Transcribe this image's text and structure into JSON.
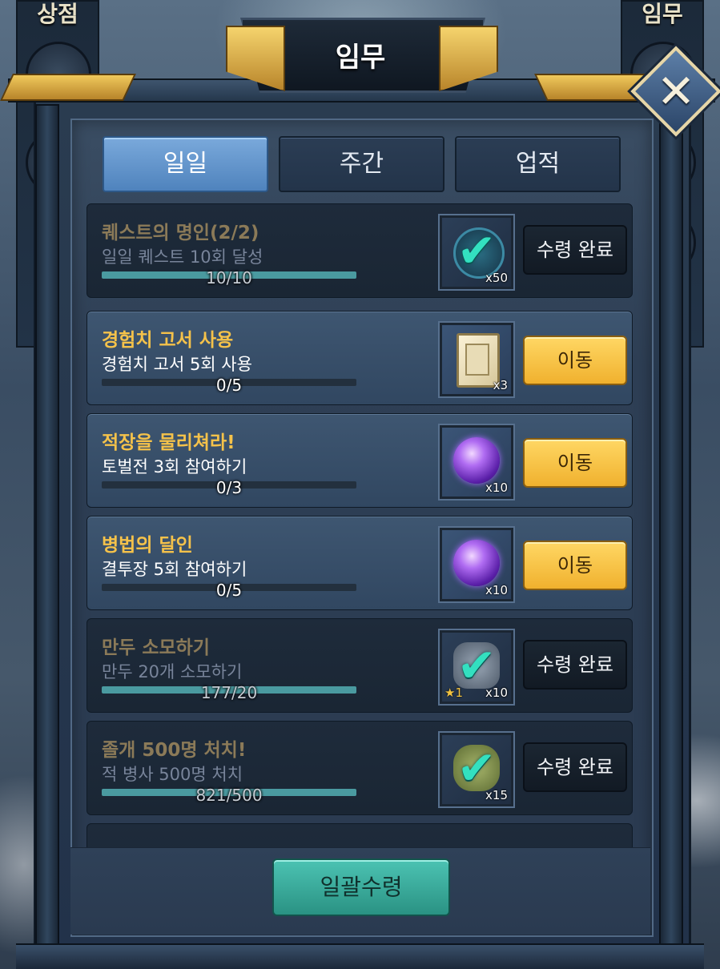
{
  "side": {
    "left_label": "상점",
    "right_label": "임무"
  },
  "window": {
    "title": "임무"
  },
  "tabs": [
    {
      "label": "일일",
      "active": true
    },
    {
      "label": "주간",
      "active": false
    },
    {
      "label": "업적",
      "active": false
    }
  ],
  "quests": [
    {
      "title": "퀘스트의 명인(2/2)",
      "desc": "일일 퀘스트 10회 달성",
      "count": "10/10",
      "progress": 1.0,
      "state": "done",
      "reward_icon": "check-icon",
      "reward_qty": "x50",
      "button": "수령 완료"
    },
    {
      "title": "경험치 고서 사용",
      "desc": "경험치 고서 5회 사용",
      "count": "0/5",
      "progress": 0.0,
      "state": "pending",
      "reward_icon": "exp-book-icon",
      "reward_qty": "x3",
      "button": "이동"
    },
    {
      "title": "적장을 물리쳐라!",
      "desc": "토벌전 3회 참여하기",
      "count": "0/3",
      "progress": 0.0,
      "state": "pending",
      "reward_icon": "purple-orb-icon",
      "reward_qty": "x10",
      "button": "이동"
    },
    {
      "title": "병법의 달인",
      "desc": "결투장 5회 참여하기",
      "count": "0/5",
      "progress": 0.0,
      "state": "pending",
      "reward_icon": "purple-orb-icon",
      "reward_qty": "x10",
      "button": "이동"
    },
    {
      "title": "만두 소모하기",
      "desc": "만두 20개 소모하기",
      "count": "177/20",
      "progress": 1.0,
      "state": "done",
      "reward_icon": "check-icon",
      "reward_qty": "x10",
      "reward_star": "★1",
      "button": "수령 완료"
    },
    {
      "title": "졸개 500명 처치!",
      "desc": "적 병사 500명 처치",
      "count": "821/500",
      "progress": 1.0,
      "state": "done",
      "reward_icon": "check-icon",
      "reward_qty": "x15",
      "button": "수령 완료"
    }
  ],
  "footer": {
    "claim_all": "일괄수령"
  }
}
